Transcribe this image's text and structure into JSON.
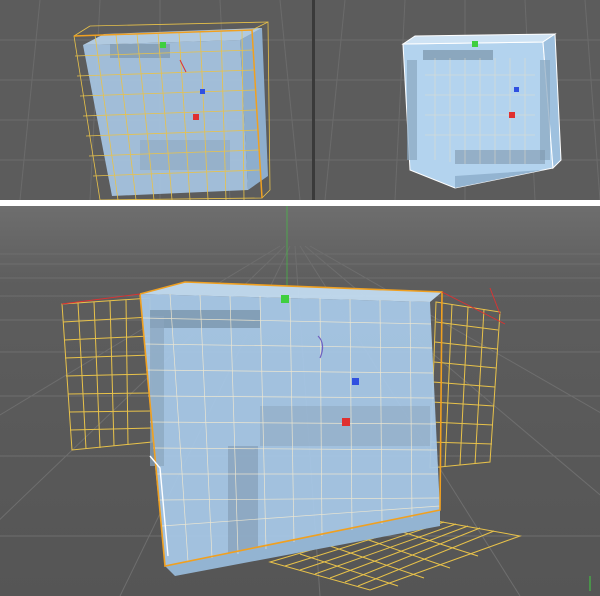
{
  "viewports": [
    {
      "id": "left",
      "mode": "wireframe-lattice"
    },
    {
      "id": "right",
      "mode": "glass-cube"
    },
    {
      "id": "bottom",
      "mode": "perspective-lattice"
    }
  ],
  "colors": {
    "viewport_bg": "#595959",
    "grid_line": "#6a6a6a",
    "cube_fill": "#a9cbe8",
    "cube_edge": "#ffffff",
    "lattice": "#e8c24a",
    "selection_edge": "#f0a020",
    "axis_x": "#e03030",
    "axis_y": "#3fcf3f",
    "axis_z": "#3050e0"
  },
  "handles": [
    "green-handle",
    "blue-handle",
    "red-handle"
  ]
}
